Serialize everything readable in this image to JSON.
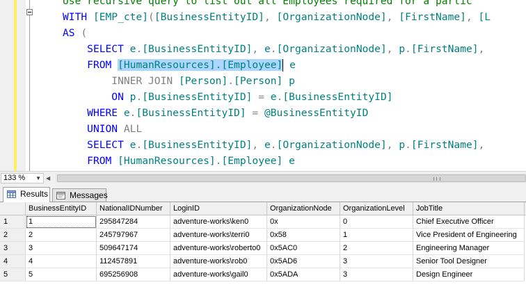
{
  "editor": {
    "lines": [
      {
        "segments": [
          {
            "t": "Use recursive query to list out all Employees required for a partic",
            "c": "cm"
          }
        ]
      },
      {
        "segments": [
          {
            "t": "WITH ",
            "c": "kw"
          },
          {
            "t": "[EMP_cte]",
            "c": "id"
          },
          {
            "t": "(",
            "c": "gray"
          },
          {
            "t": "[BusinessEntityID]",
            "c": "id"
          },
          {
            "t": ", ",
            "c": "gray"
          },
          {
            "t": "[OrganizationNode]",
            "c": "id"
          },
          {
            "t": ", ",
            "c": "gray"
          },
          {
            "t": "[FirstName]",
            "c": "id"
          },
          {
            "t": ", ",
            "c": "gray"
          },
          {
            "t": "[L",
            "c": "id"
          }
        ]
      },
      {
        "segments": [
          {
            "t": "AS ",
            "c": "kw"
          },
          {
            "t": "(",
            "c": "gray"
          }
        ]
      },
      {
        "segments": [
          {
            "t": "    "
          },
          {
            "t": "SELECT ",
            "c": "kw"
          },
          {
            "t": "e",
            "c": "id"
          },
          {
            "t": ".",
            "c": "gray"
          },
          {
            "t": "[BusinessEntityID]",
            "c": "id"
          },
          {
            "t": ", ",
            "c": "gray"
          },
          {
            "t": "e",
            "c": "id"
          },
          {
            "t": ".",
            "c": "gray"
          },
          {
            "t": "[OrganizationNode]",
            "c": "id"
          },
          {
            "t": ", ",
            "c": "gray"
          },
          {
            "t": "p",
            "c": "id"
          },
          {
            "t": ".",
            "c": "gray"
          },
          {
            "t": "[FirstName]",
            "c": "id"
          },
          {
            "t": ",",
            "c": "gray"
          }
        ]
      },
      {
        "segments": [
          {
            "t": "    "
          },
          {
            "t": "FROM ",
            "c": "kw"
          },
          {
            "t": "[HumanResources].[Employee]",
            "c": "id",
            "hl": true
          },
          {
            "caret": true
          },
          {
            "t": " e",
            "c": "id"
          }
        ]
      },
      {
        "segments": [
          {
            "t": "        "
          },
          {
            "t": "INNER JOIN ",
            "c": "gray"
          },
          {
            "t": "[Person]",
            "c": "id"
          },
          {
            "t": ".",
            "c": "gray"
          },
          {
            "t": "[Person]",
            "c": "id"
          },
          {
            "t": " p",
            "c": "id"
          }
        ]
      },
      {
        "segments": [
          {
            "t": "        "
          },
          {
            "t": "ON ",
            "c": "kw"
          },
          {
            "t": "p",
            "c": "id"
          },
          {
            "t": ".",
            "c": "gray"
          },
          {
            "t": "[BusinessEntityID]",
            "c": "id"
          },
          {
            "t": " = ",
            "c": "gray"
          },
          {
            "t": "e",
            "c": "id"
          },
          {
            "t": ".",
            "c": "gray"
          },
          {
            "t": "[BusinessEntityID]",
            "c": "id"
          }
        ]
      },
      {
        "segments": [
          {
            "t": "    "
          },
          {
            "t": "WHERE ",
            "c": "kw"
          },
          {
            "t": "e",
            "c": "id"
          },
          {
            "t": ".",
            "c": "gray"
          },
          {
            "t": "[BusinessEntityID]",
            "c": "id"
          },
          {
            "t": " = ",
            "c": "gray"
          },
          {
            "t": "@BusinessEntityID",
            "c": "id"
          }
        ]
      },
      {
        "segments": [
          {
            "t": "    "
          },
          {
            "t": "UNION ",
            "c": "kw"
          },
          {
            "t": "ALL",
            "c": "gray"
          }
        ]
      },
      {
        "segments": [
          {
            "t": "    "
          },
          {
            "t": "SELECT ",
            "c": "kw"
          },
          {
            "t": "e",
            "c": "id"
          },
          {
            "t": ".",
            "c": "gray"
          },
          {
            "t": "[BusinessEntityID]",
            "c": "id"
          },
          {
            "t": ", ",
            "c": "gray"
          },
          {
            "t": "e",
            "c": "id"
          },
          {
            "t": ".",
            "c": "gray"
          },
          {
            "t": "[OrganizationNode]",
            "c": "id"
          },
          {
            "t": ", ",
            "c": "gray"
          },
          {
            "t": "p",
            "c": "id"
          },
          {
            "t": ".",
            "c": "gray"
          },
          {
            "t": "[FirstName]",
            "c": "id"
          },
          {
            "t": ",",
            "c": "gray"
          }
        ]
      },
      {
        "segments": [
          {
            "t": "    "
          },
          {
            "t": "FROM ",
            "c": "kw"
          },
          {
            "t": "[HumanResources]",
            "c": "id"
          },
          {
            "t": ".",
            "c": "gray"
          },
          {
            "t": "[Employee]",
            "c": "id"
          },
          {
            "t": " e",
            "c": "id"
          }
        ]
      },
      {
        "segments": [
          {
            "t": "        "
          },
          {
            "t": "INNER JOIN ",
            "c": "gray"
          },
          {
            "t": "[EMP_cte]",
            "c": "id"
          }
        ]
      }
    ]
  },
  "zoom": {
    "value": "133 %"
  },
  "tabs": {
    "results": "Results",
    "messages": "Messages"
  },
  "grid": {
    "columns": [
      "BusinessEntityID",
      "NationalIDNumber",
      "LoginID",
      "OrganizationNode",
      "OrganizationLevel",
      "JobTitle"
    ],
    "rows": [
      {
        "n": "1",
        "cells": [
          "1",
          "295847284",
          "adventure-works\\ken0",
          "0x",
          "0",
          "Chief Executive Officer"
        ]
      },
      {
        "n": "2",
        "cells": [
          "2",
          "245797967",
          "adventure-works\\terri0",
          "0x58",
          "1",
          "Vice President of Engineering"
        ]
      },
      {
        "n": "3",
        "cells": [
          "3",
          "509647174",
          "adventure-works\\roberto0",
          "0x5AC0",
          "2",
          "Engineering Manager"
        ]
      },
      {
        "n": "4",
        "cells": [
          "4",
          "112457891",
          "adventure-works\\rob0",
          "0x5AD6",
          "3",
          "Senior Tool Designer"
        ]
      },
      {
        "n": "5",
        "cells": [
          "5",
          "695256908",
          "adventure-works\\gail0",
          "0x5ADA",
          "3",
          "Design Engineer"
        ]
      }
    ]
  }
}
